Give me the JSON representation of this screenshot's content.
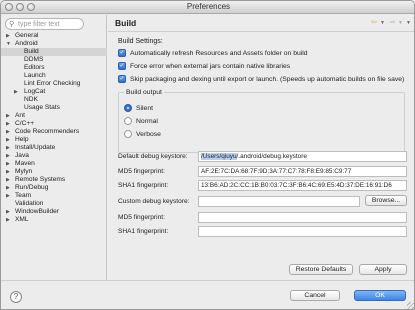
{
  "window": {
    "title": "Preferences"
  },
  "sidebar": {
    "filter_placeholder": "type filter text",
    "items": [
      {
        "label": "General",
        "expand": "▶"
      },
      {
        "label": "Android",
        "expand": "▼"
      },
      {
        "label": "Build",
        "expand": "",
        "selected": true
      },
      {
        "label": "DDMS",
        "expand": ""
      },
      {
        "label": "Editors",
        "expand": ""
      },
      {
        "label": "Launch",
        "expand": ""
      },
      {
        "label": "Lint Error Checking",
        "expand": ""
      },
      {
        "label": "LogCat",
        "expand": "▶"
      },
      {
        "label": "NDK",
        "expand": ""
      },
      {
        "label": "Usage Stats",
        "expand": ""
      },
      {
        "label": "Ant",
        "expand": "▶"
      },
      {
        "label": "C/C++",
        "expand": "▶"
      },
      {
        "label": "Code Recommenders",
        "expand": "▶"
      },
      {
        "label": "Help",
        "expand": "▶"
      },
      {
        "label": "Install/Update",
        "expand": "▶"
      },
      {
        "label": "Java",
        "expand": "▶"
      },
      {
        "label": "Maven",
        "expand": "▶"
      },
      {
        "label": "Mylyn",
        "expand": "▶"
      },
      {
        "label": "Remote Systems",
        "expand": "▶"
      },
      {
        "label": "Run/Debug",
        "expand": "▶"
      },
      {
        "label": "Team",
        "expand": "▶"
      },
      {
        "label": "Validation",
        "expand": ""
      },
      {
        "label": "WindowBuilder",
        "expand": "▶"
      },
      {
        "label": "XML",
        "expand": "▶"
      }
    ]
  },
  "page": {
    "title": "Build",
    "settings_label": "Build Settings:",
    "checkboxes": [
      "Automatically refresh Resources and Assets folder on build",
      "Force error when external jars contain native libraries",
      "Skip packaging and dexing until export or launch. (Speeds up automatic builds on file save)"
    ],
    "output_group": {
      "label": "Build output",
      "options": [
        "Silent",
        "Normal",
        "Verbose"
      ],
      "selected": "Silent"
    },
    "default_keystore_label": "Default debug keystore:",
    "default_keystore_hl": "/Users/qiuyu",
    "default_keystore_rest": "/.android/debug.keystore",
    "md5_label": "MD5 fingerprint:",
    "md5_value": "AF:2E:7C:DA:68:7F:9D:3A:77:C7:78:F8:E9:85:C9:77",
    "sha1_label": "SHA1 fingerprint:",
    "sha1_value": "13:B6:AD:2C:CC:1B:B0:03:7C:3F:B6:4C:69:E5:4D:37:DE:16:91:D6",
    "custom_keystore_label": "Custom debug keystore:",
    "custom_keystore_value": "",
    "browse_label": "Browse...",
    "custom_md5_label": "MD5 fingerprint:",
    "custom_sha1_label": "SHA1 fingerprint:",
    "restore_label": "Restore Defaults",
    "apply_label": "Apply"
  },
  "footer": {
    "help_label": "?",
    "cancel_label": "Cancel",
    "ok_label": "OK"
  },
  "colors": {
    "accent": "#3e85e6",
    "selection": "#d4d4d4",
    "highlight": "#b7d0f2"
  }
}
